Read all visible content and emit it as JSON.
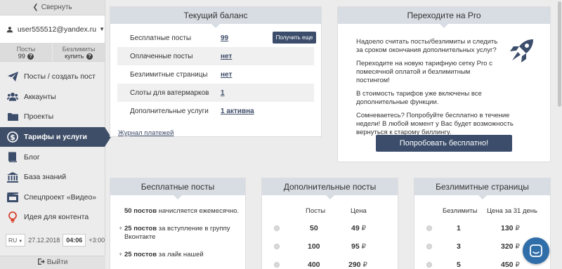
{
  "sidebar": {
    "collapse_label": "Свернуть",
    "user_email": "user555512@yandex.ru",
    "stats": [
      {
        "label": "Посты",
        "value": "99"
      },
      {
        "label": "Безлимиты",
        "value": "купить"
      }
    ],
    "items": [
      {
        "label": "Посты / создать пост",
        "icon": "send-icon"
      },
      {
        "label": "Аккаунты",
        "icon": "users-icon"
      },
      {
        "label": "Проекты",
        "icon": "folder-icon"
      },
      {
        "label": "Тарифы и услуги",
        "icon": "dollar-icon"
      },
      {
        "label": "Блог",
        "icon": "book-icon"
      },
      {
        "label": "База знаний",
        "icon": "building-icon"
      },
      {
        "label": "Спецпроект «Видео»",
        "icon": "film-icon"
      },
      {
        "label": "Идея для контента",
        "icon": "lightbulb-icon"
      }
    ],
    "lang": "RU",
    "date": "27.12.2018",
    "time": "04:06",
    "tz": "+3:00",
    "logout_label": "Выйти"
  },
  "balance": {
    "title": "Текущий баланс",
    "rows": [
      {
        "key": "Бесплатные посты",
        "value": "99"
      },
      {
        "key": "Оплаченные посты",
        "value": "нет"
      },
      {
        "key": "Безлимитные страницы",
        "value": "нет"
      },
      {
        "key": "Слоты для ватермарков",
        "value": "1"
      },
      {
        "key": "Дополнительные услуги",
        "value": "1 активна"
      }
    ],
    "more_button": "Получить еще",
    "journal_link": "Журнал платежей"
  },
  "pro": {
    "title": "Переходите на Pro",
    "p1": "Надоело считать посты/безлимиты и следить за сроком окончания дополнительных услуг?",
    "p2": "Переходите на новую тарифную сетку Pro с помесячной оплатой и безлимитным постингом!",
    "p3": "В стоимость тарифов уже включены все дополнительные функции.",
    "p4": "Сомневаетесь? Попробуйте бесплатно в течение недели! В любой момент у Вас будет возможность вернуться к старому биллингу.",
    "button": "Попробовать бесплатно!"
  },
  "free_posts": {
    "title": "Бесплатные посты",
    "item1_bold": "50 постов",
    "item1_rest": "начисляется ежемесячно.",
    "item2_prefix": "+",
    "item2_bold": "25 постов",
    "item2_rest": "за вступление в группу Вконтакте",
    "item3_prefix": "+",
    "item3_bold": "25 постов",
    "item3_rest": "за лайк нашей"
  },
  "extra_posts": {
    "title": "Дополнительные посты",
    "col1": "Посты",
    "col2": "Цена",
    "rows": [
      {
        "count": "50",
        "price": "49"
      },
      {
        "count": "100",
        "price": "95"
      },
      {
        "count": "400",
        "price": "290"
      }
    ]
  },
  "unlimited_pages": {
    "title": "Безлимитные страницы",
    "col1": "Безлимиты",
    "col2": "Цена за 31 день",
    "rows": [
      {
        "count": "1",
        "price": "130"
      },
      {
        "count": "3",
        "price": "320"
      },
      {
        "count": "5",
        "price": "450"
      }
    ]
  },
  "currency": "₽",
  "colors": {
    "accent": "#3c4d6b",
    "header_bg": "#d8dde3",
    "chat": "#2f6ea9"
  }
}
